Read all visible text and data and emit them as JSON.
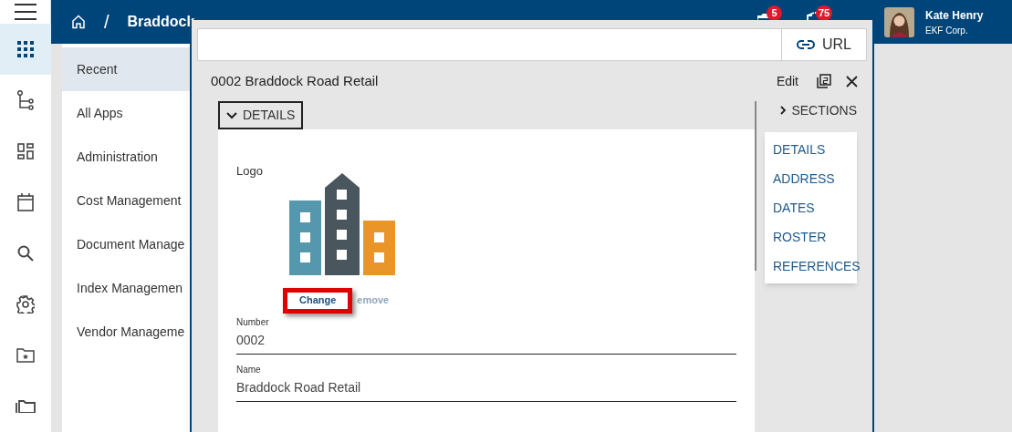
{
  "rail": [
    {
      "kind": "apps",
      "selected": true
    },
    {
      "kind": "tree",
      "selected": false
    },
    {
      "kind": "dashboard",
      "selected": false
    },
    {
      "kind": "calendar",
      "selected": false
    },
    {
      "kind": "search",
      "selected": false
    },
    {
      "kind": "settings",
      "selected": false
    },
    {
      "kind": "folderstar",
      "selected": false
    },
    {
      "kind": "folders",
      "selected": false
    }
  ],
  "breadcrumb": {
    "separator": "/",
    "current": "Braddock"
  },
  "notifications": [
    {
      "kind": "flag",
      "count": "5"
    },
    {
      "kind": "arrow",
      "count": "75"
    }
  ],
  "user": {
    "name": "Kate Henry",
    "company": "EKF Corp."
  },
  "menu": [
    {
      "label": "Recent",
      "selected": true
    },
    {
      "label": "All Apps",
      "selected": false
    },
    {
      "label": "Administration",
      "selected": false
    },
    {
      "label": "Cost Management",
      "selected": false
    },
    {
      "label": "Document Manage",
      "selected": false
    },
    {
      "label": "Index Managemen",
      "selected": false
    },
    {
      "label": "Vendor Manageme",
      "selected": false
    }
  ],
  "dialog": {
    "url_button": "URL",
    "title": "0002 Braddock Road Retail",
    "edit": "Edit",
    "section_toggle": {
      "label": "DETAILS",
      "expanded": true
    },
    "logo_label": "Logo",
    "logo_actions": [
      {
        "label": "Change",
        "disabled": false,
        "highlighted": true
      },
      {
        "label": "emove",
        "disabled": true,
        "highlighted": false
      }
    ],
    "fields": [
      {
        "label": "Number",
        "value": "0002"
      },
      {
        "label": "Name",
        "value": "Braddock Road Retail"
      }
    ],
    "sections": {
      "label": "SECTIONS",
      "expanded": false,
      "items": [
        "DETAILS",
        "ADDRESS",
        "DATES",
        "ROSTER",
        "REFERENCES"
      ]
    }
  }
}
